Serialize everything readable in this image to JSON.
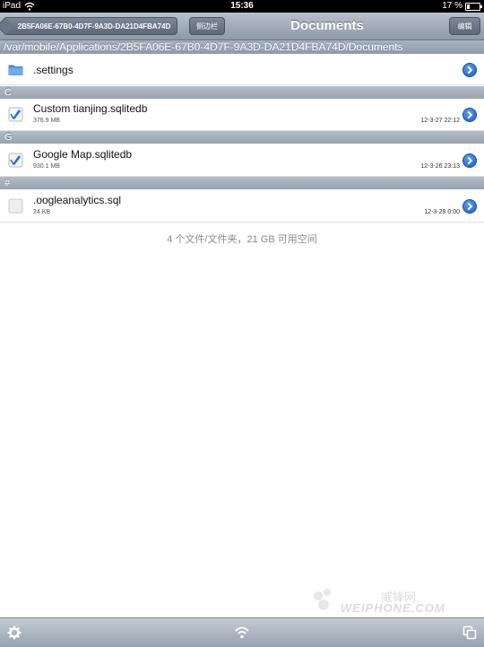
{
  "status_bar": {
    "carrier": "iPad",
    "time": "15:36",
    "battery_percent": "17 %",
    "battery_level": 0.17
  },
  "nav": {
    "back_label": "2B5FA06E-67B0-4D7F-9A3D-DA21D4FBA74D",
    "sidebar_label": "侧边栏",
    "title": "Documents",
    "edit_label": "编辑"
  },
  "path": "/var/mobile/Applications/2B5FA06E-67B0-4D7F-9A3D-DA21D4FBA74D/Documents",
  "sections": [
    {
      "header": "C"
    },
    {
      "header": "G"
    },
    {
      "header": "#"
    }
  ],
  "items": [
    {
      "name": ".settings",
      "type": "folder-icon"
    },
    {
      "name": "Custom tianjing.sqlitedb",
      "size": "376.9 MB",
      "date": "12-3-27 22:12",
      "type": "database-file-icon"
    },
    {
      "name": "Google Map.sqlitedb",
      "size": "930.1 MB",
      "date": "12-3-26 23:13",
      "type": "database-file-icon"
    },
    {
      "name": ".oogleanalytics.sql",
      "size": "24 KB",
      "date": "12-3-28 0:00",
      "type": "blank-file-icon"
    }
  ],
  "summary": "4 个文件/文件夹，21 GB 可用空间",
  "watermark": {
    "brand": "威锋网",
    "logo": "WEIPHONE.COM"
  },
  "colors": {
    "accent": "#1f5fc8",
    "nav_bar": "#9aa5b2"
  }
}
